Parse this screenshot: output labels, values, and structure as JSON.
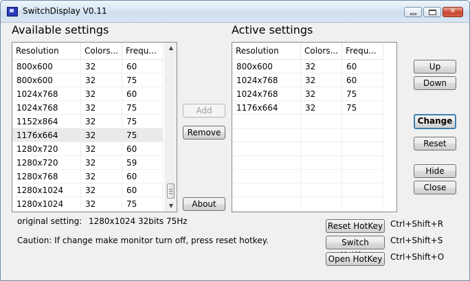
{
  "window": {
    "title": "SwitchDisplay V0.11",
    "caption_buttons": {
      "minimize": "minimize",
      "maximize": "maximize",
      "close": "✕"
    }
  },
  "available": {
    "heading": "Available settings",
    "columns": [
      "Resolution",
      "Colors...",
      "Frequ..."
    ],
    "rows": [
      [
        "800x600",
        "32",
        "60"
      ],
      [
        "800x600",
        "32",
        "75"
      ],
      [
        "1024x768",
        "32",
        "60"
      ],
      [
        "1024x768",
        "32",
        "75"
      ],
      [
        "1152x864",
        "32",
        "75"
      ],
      [
        "1176x664",
        "32",
        "75"
      ],
      [
        "1280x720",
        "32",
        "60"
      ],
      [
        "1280x720",
        "32",
        "59"
      ],
      [
        "1280x768",
        "32",
        "60"
      ],
      [
        "1280x1024",
        "32",
        "60"
      ],
      [
        "1280x1024",
        "32",
        "75"
      ]
    ],
    "selected_row": 5,
    "scrollbar": {
      "up_icon": "▲",
      "down_icon": "▼"
    }
  },
  "active": {
    "heading": "Active settings",
    "columns": [
      "Resolution",
      "Colors...",
      "Frequ..."
    ],
    "rows": [
      [
        "800x600",
        "32",
        "60"
      ],
      [
        "1024x768",
        "32",
        "60"
      ],
      [
        "1024x768",
        "32",
        "75"
      ],
      [
        "1176x664",
        "32",
        "75"
      ]
    ],
    "empty_rows": 7
  },
  "buttons": {
    "add": "Add",
    "remove": "Remove",
    "about": "About",
    "up": "Up",
    "down": "Down",
    "change": "Change",
    "reset": "Reset",
    "hide": "Hide",
    "close": "Close",
    "reset_hotkey": "Reset HotKey",
    "switch_hotkey": "Switch HotKey",
    "open_hotkey": "Open HotKey"
  },
  "hotkeys": {
    "reset": "Ctrl+Shift+R",
    "switch": "Ctrl+Shift+S",
    "open": "Ctrl+Shift+O"
  },
  "info": {
    "original_label": "original setting:",
    "original_value": "1280x1024 32bits 75Hz",
    "caution": "Caution: If change make monitor turn off, press reset hotkey."
  }
}
